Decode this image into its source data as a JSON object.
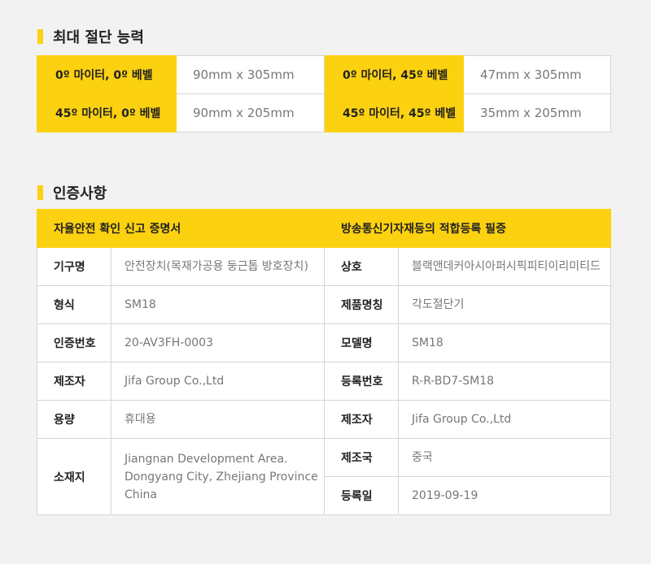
{
  "capacity": {
    "title": "최대 절단 능력",
    "rows": [
      {
        "label1": "0º 마이터, 0º 베벨",
        "value1": "90mm x 305mm",
        "label2": "0º 마이터, 45º 베벨",
        "value2": "47mm x 305mm"
      },
      {
        "label1": "45º 마이터, 0º 베벨",
        "value1": "90mm x 205mm",
        "label2": "45º 마이터, 45º 베벨",
        "value2": "35mm x 205mm"
      }
    ]
  },
  "cert": {
    "title": "인증사항",
    "head_left": "자율안전 확인 신고 증명서",
    "head_right": "방송통신기자재등의 적합등록 필증",
    "left": [
      {
        "label": "기구명",
        "value": "안전장치(목재가공용 둥근톱 방호장치)"
      },
      {
        "label": "형식",
        "value": "SM18"
      },
      {
        "label": "인증번호",
        "value": "20-AV3FH-0003"
      },
      {
        "label": "제조자",
        "value": "Jifa Group Co.,Ltd"
      },
      {
        "label": "용량",
        "value": "휴대용"
      },
      {
        "label": "소재지",
        "value_line1": "Jiangnan Development Area.",
        "value_line2": "Dongyang City, Zhejiang Province China"
      }
    ],
    "right": [
      {
        "label": "상호",
        "value": "블랙앤데커아시아퍼시픽피티이리미티드"
      },
      {
        "label": "제품명칭",
        "value": "각도절단기"
      },
      {
        "label": "모델명",
        "value": "SM18"
      },
      {
        "label": "등록번호",
        "value": "R-R-BD7-SM18"
      },
      {
        "label": "제조자",
        "value": "Jifa Group Co.,Ltd"
      },
      {
        "label": "제조국",
        "value": "중국"
      },
      {
        "label": "등록일",
        "value": "2019-09-19"
      }
    ]
  }
}
